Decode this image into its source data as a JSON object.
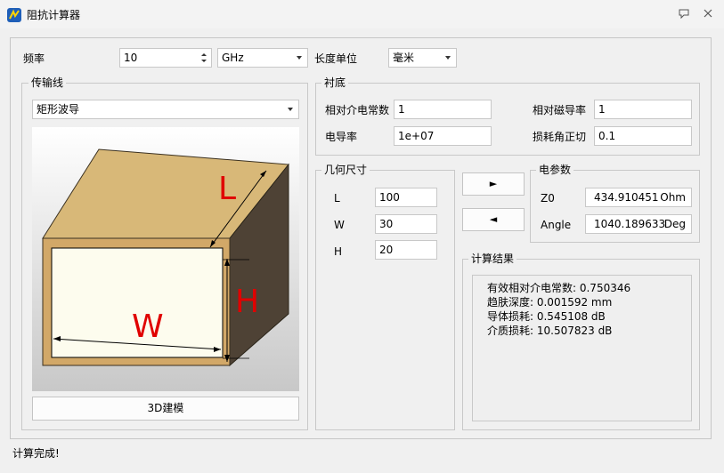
{
  "window": {
    "title": "阻抗计算器"
  },
  "top": {
    "freq_label": "频率",
    "freq_value": "10",
    "freq_unit": "GHz",
    "length_unit_label": "长度单位",
    "length_unit_value": "毫米"
  },
  "transmission_line": {
    "group_title": "传输线",
    "type_value": "矩形波导",
    "diagram_labels": {
      "L": "L",
      "W": "W",
      "H": "H"
    },
    "model_button": "3D建模"
  },
  "substrate": {
    "group_title": "衬底",
    "fields": [
      {
        "label": "相对介电常数",
        "value": "1"
      },
      {
        "label": "相对磁导率",
        "value": "1"
      },
      {
        "label": "电导率",
        "value": "1e+07"
      },
      {
        "label": "损耗角正切",
        "value": "0.1"
      }
    ]
  },
  "geometry": {
    "group_title": "几何尺寸",
    "fields": [
      {
        "label": "L",
        "value": "100"
      },
      {
        "label": "W",
        "value": "30"
      },
      {
        "label": "H",
        "value": "20"
      }
    ]
  },
  "arrows": {
    "forward": "►",
    "backward": "◄"
  },
  "electrical": {
    "group_title": "电参数",
    "fields": [
      {
        "label": "Z0",
        "value": "434.910451",
        "unit": "Ohm"
      },
      {
        "label": "Angle",
        "value": "1040.189633",
        "unit": "Deg"
      }
    ]
  },
  "results": {
    "group_title": "计算结果",
    "lines": [
      "有效相对介电常数: 0.750346",
      "趋肤深度: 0.001592 mm",
      "导体损耗: 0.545108 dB",
      "介质损耗: 10.507823 dB"
    ]
  },
  "status": {
    "text": "计算完成!"
  },
  "colors": {
    "box_top": "#d8b878",
    "box_front": "#d2a868",
    "box_side": "#4e4235",
    "inner": "#fdfcee",
    "label_red": "#e00000"
  }
}
